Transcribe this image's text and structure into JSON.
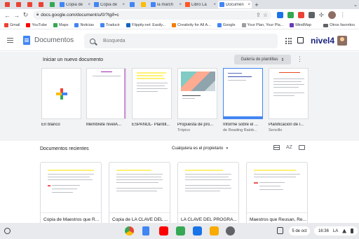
{
  "browser": {
    "tabs": [
      {
        "label": "",
        "favicon": "gmail",
        "color": "#ea4335",
        "width": "small"
      },
      {
        "label": "",
        "favicon": "gmail",
        "color": "#ea4335",
        "width": "small"
      },
      {
        "label": "",
        "favicon": "gmail",
        "color": "#ea4335",
        "width": "small"
      },
      {
        "label": "",
        "favicon": "gmail",
        "color": "#ea4335",
        "width": "small"
      },
      {
        "label": "",
        "favicon": "classroom",
        "color": "#34a853",
        "width": "small"
      },
      {
        "label": "Copia de",
        "favicon": "docs",
        "color": "#4285f4",
        "width": "wide"
      },
      {
        "label": "Copia de",
        "favicon": "docs",
        "color": "#4285f4",
        "width": "wide"
      },
      {
        "label": "",
        "favicon": "google",
        "color": "#4285f4",
        "width": "small"
      },
      {
        "label": "",
        "favicon": "google",
        "color": "#fbbc04",
        "width": "small"
      },
      {
        "label": "la march",
        "favicon": "google",
        "color": "#4285f4",
        "width": "wide"
      },
      {
        "label": "Libro La",
        "favicon": "orange",
        "color": "#ff5722",
        "width": "wide"
      },
      {
        "label": "Documen",
        "favicon": "docs",
        "color": "#4285f4",
        "width": "wide",
        "active": true
      }
    ],
    "new_tab_label": "+",
    "url": "docs.google.com/document/u/0/?tgif=c",
    "bookmarks": [
      {
        "label": "Gmail",
        "color": "#ea4335"
      },
      {
        "label": "YouTube",
        "color": "#ff0000"
      },
      {
        "label": "Maps",
        "color": "#34a853"
      },
      {
        "label": "Noticias",
        "color": "#4285f4"
      },
      {
        "label": "Traducir",
        "color": "#4285f4"
      },
      {
        "label": "Flippity.net: Easily...",
        "color": "#1565c0"
      },
      {
        "label": "Creativity for All A...",
        "color": "#f57c00"
      },
      {
        "label": "Google",
        "color": "#4285f4"
      },
      {
        "label": "Your Plan, Your Pla...",
        "color": "#9e9e9e"
      },
      {
        "label": "MindMap",
        "color": "#673ab7"
      }
    ],
    "other_bookmarks": "Otros favoritos"
  },
  "header": {
    "app_name": "Documentos",
    "search_placeholder": "Búsqueda",
    "brand": "nivel4"
  },
  "templates": {
    "heading": "Iniciar un nuevo documento",
    "gallery_label": "Galería de plantillas",
    "items": [
      {
        "name": "En blanco",
        "sub": ""
      },
      {
        "name": "Membrete nivelA...",
        "sub": ""
      },
      {
        "name": "ESPAÑOL- Plantill...",
        "sub": ""
      },
      {
        "name": "Propuesta de pro...",
        "sub": "Trópico"
      },
      {
        "name": "Informe sobre el ...",
        "sub": "de Reading Rainb..."
      },
      {
        "name": "Planificación de l...",
        "sub": "Sencillo"
      }
    ]
  },
  "recent": {
    "heading": "Documentos recientes",
    "owner_filter": "Cualquiera es el propietario",
    "sort_label": "AZ",
    "docs": [
      {
        "title": "Copia de Maestros que R..."
      },
      {
        "title": "Copia de LA CLAVE DEL ..."
      },
      {
        "title": "LA CLAVE DEL PROGRA..."
      },
      {
        "title": "Maestros que Reusan, Re..."
      }
    ]
  },
  "shelf": {
    "date": "5 de oct",
    "time": "16:36",
    "locale": "LA"
  }
}
